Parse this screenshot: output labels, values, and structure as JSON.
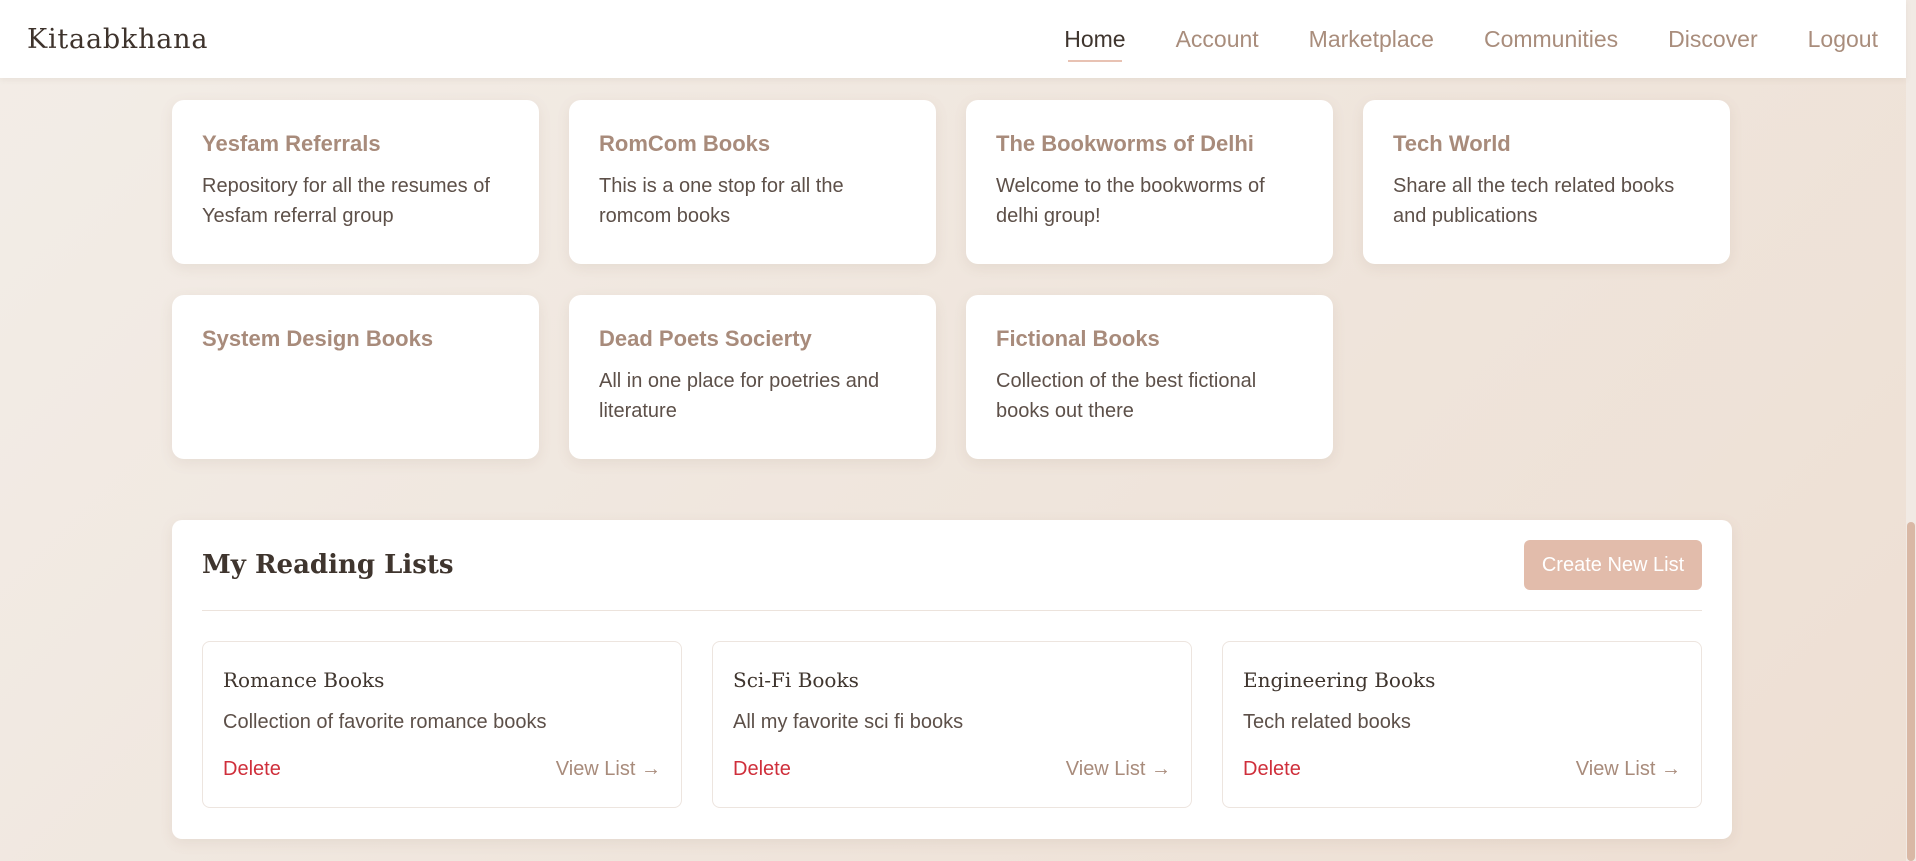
{
  "nav": {
    "brand": "Kitaabkhana",
    "links": [
      {
        "label": "Home",
        "active": true
      },
      {
        "label": "Account"
      },
      {
        "label": "Marketplace"
      },
      {
        "label": "Communities"
      },
      {
        "label": "Discover"
      },
      {
        "label": "Logout"
      }
    ]
  },
  "communities": [
    {
      "name": "Yesfam Referrals",
      "description": "Repository for all the resumes of Yesfam referral group"
    },
    {
      "name": "RomCom Books",
      "description": "This is a one stop for all the romcom books"
    },
    {
      "name": "The Bookworms of Delhi",
      "description": "Welcome to the bookworms of delhi group!"
    },
    {
      "name": "Tech World",
      "description": "Share all the tech related books and publications"
    },
    {
      "name": "System Design Books",
      "description": ""
    },
    {
      "name": "Dead Poets Socierty",
      "description": "All in one place for poetries and literature"
    },
    {
      "name": "Fictional Books",
      "description": "Collection of the best fictional books out there"
    }
  ],
  "reading_lists": {
    "title": "My Reading Lists",
    "create_label": "Create New List",
    "lists": [
      {
        "name": "Romance Books",
        "description": "Collection of favorite romance books",
        "delete_label": "Delete",
        "view_label": "View List →"
      },
      {
        "name": "Sci-Fi Books",
        "description": "All my favorite sci fi books",
        "delete_label": "Delete",
        "view_label": "View List →"
      },
      {
        "name": "Engineering Books",
        "description": "Tech related books",
        "delete_label": "Delete",
        "view_label": "View List →"
      }
    ]
  },
  "colors": {
    "accent": "#e2bcab",
    "heading": "#a88b7b",
    "danger": "#cf2f3b"
  }
}
